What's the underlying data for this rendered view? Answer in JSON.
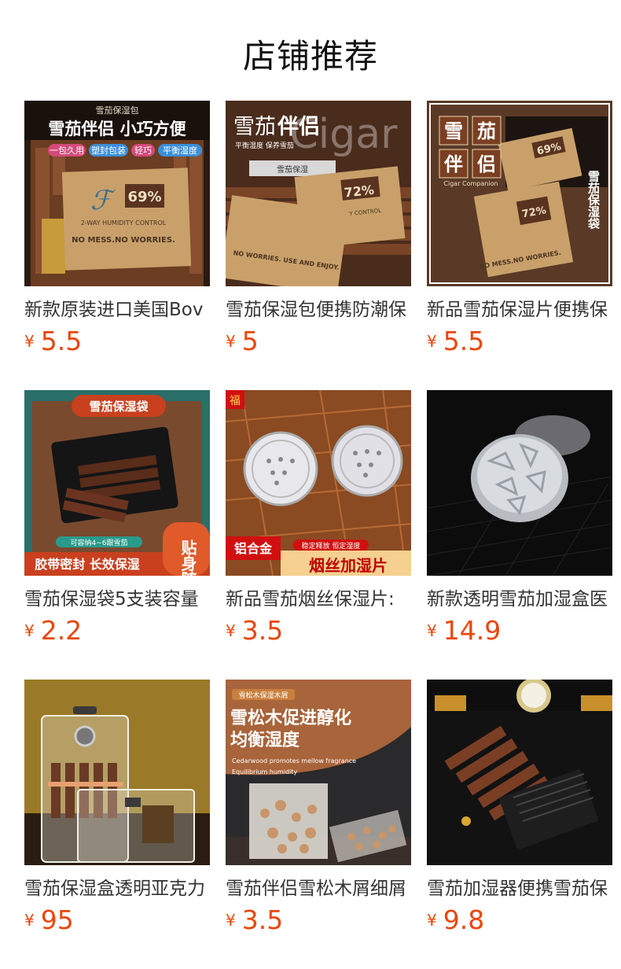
{
  "section": {
    "title": "店铺推荐"
  },
  "currency_symbol": "¥",
  "colors": {
    "price": "#e8470b"
  },
  "products": [
    {
      "name": "新款原装进口美国Bov",
      "price": "5.5",
      "image": {
        "header": "雪茄保湿包",
        "headline": "雪茄伴侣 小巧方便",
        "tags": [
          "一包久用",
          "塑封包装",
          "轻巧",
          "平衡湿度"
        ],
        "percent": "69%",
        "line1": "2-WAY HUMIDITY CONTROL",
        "line2": "NO MESS.NO WORRIES."
      }
    },
    {
      "name": "雪茄保湿包便携防潮保",
      "price": "5",
      "image": {
        "headline_a": "雪茄",
        "headline_b": "伴侣",
        "watermark": "Cigar",
        "sub": "平衡湿度 保养雪茄",
        "label": "雪茄保湿",
        "percent": "72%",
        "line1": "2-WAY HUMIDITY CONTROL",
        "line2": "NO WORRIES. USE AND ENJOY."
      }
    },
    {
      "name": "新品雪茄保湿片便携保",
      "price": "5.5",
      "image": {
        "chars": [
          "雪",
          "茄",
          "伴",
          "侣"
        ],
        "caption": "Cigar Companion",
        "side": "雪茄保湿袋",
        "percent_a": "69%",
        "percent_b": "72%",
        "line2": "NO MESS.NO WORRIES."
      }
    },
    {
      "name": "雪茄保湿袋5支装容量",
      "price": "2.2",
      "image": {
        "banner": "雪茄保湿袋",
        "capacity": "可容纳4~6跟雪茄",
        "footer": "胶带密封 长效保湿",
        "badge": "贴身随行"
      }
    },
    {
      "name": "新品雪茄烟丝保湿片: ",
      "price": "3.5",
      "image": {
        "corner": "福",
        "material": "铝合金",
        "tagline": "稳定释放 恒定湿度",
        "footer": "烟丝加湿片"
      }
    },
    {
      "name": "新款透明雪茄加湿盒医",
      "price": "14.9",
      "image": {}
    },
    {
      "name": "雪茄保湿盒透明亚克力",
      "price": "95",
      "image": {}
    },
    {
      "name": "雪茄伴侣雪松木屑细屑",
      "price": "3.5",
      "image": {
        "tag": "雪松木保湿木屑",
        "headline": "雪松木促进醇化",
        "headline2": "均衡湿度",
        "en1": "Cedarwood promotes mellow fragrance",
        "en2": "Equilibrium humidity"
      }
    },
    {
      "name": "雪茄加湿器便携雪茄保",
      "price": "9.8",
      "image": {}
    }
  ]
}
